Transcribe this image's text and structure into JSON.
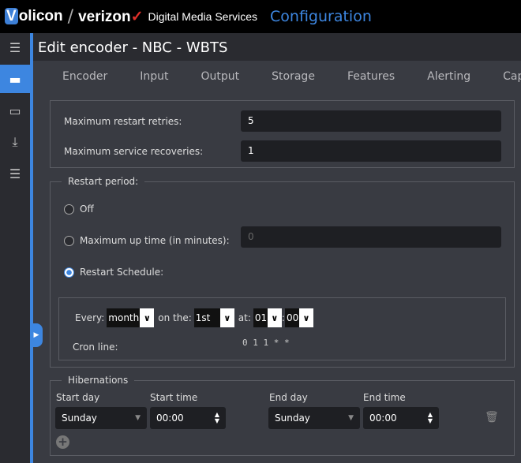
{
  "header": {
    "brand_v": "V",
    "brand_rest": "olicon",
    "slash": "/",
    "verizon": "verizon",
    "check": "✓",
    "dms": "Digital Media Services",
    "section": "Configuration"
  },
  "page_title": "Edit encoder - NBC - WBTS",
  "tabs": [
    "Encoder",
    "Input",
    "Output",
    "Storage",
    "Features",
    "Alerting",
    "Captions"
  ],
  "limits": {
    "restart_retries_label": "Maximum restart retries:",
    "restart_retries": "5",
    "service_recoveries_label": "Maximum service recoveries:",
    "service_recoveries": "1"
  },
  "restart": {
    "legend": "Restart period:",
    "off": "Off",
    "max_up": "Maximum up time (in minutes):",
    "max_up_placeholder": "0",
    "schedule": "Restart Schedule:",
    "selected": "schedule",
    "every_label": "Every:",
    "every": "month",
    "on_label": "on the:",
    "on": "1st",
    "at_label": "at:",
    "hour": "01",
    "colon": ":",
    "minute": "00",
    "cron_label": "Cron line:",
    "cron": "0 1 1 * *"
  },
  "hibernations": {
    "legend": "Hibernations",
    "start_day_label": "Start day",
    "start_time_label": "Start time",
    "end_day_label": "End day",
    "end_time_label": "End time",
    "rows": [
      {
        "start_day": "Sunday",
        "start_time": "00:00",
        "end_day": "Sunday",
        "end_time": "00:00"
      }
    ]
  }
}
